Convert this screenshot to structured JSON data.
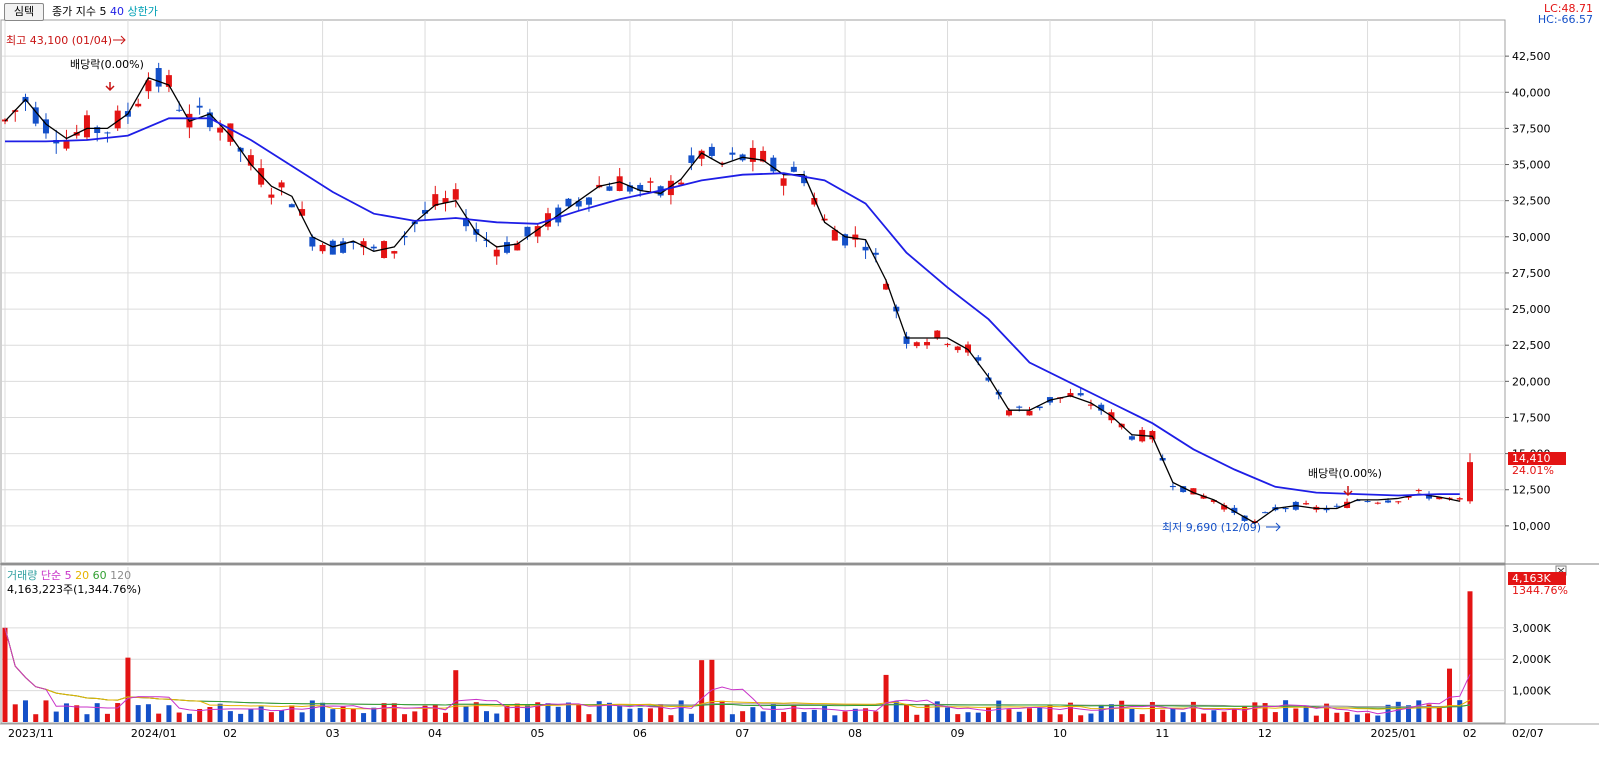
{
  "toolbar": {
    "button_label": "심텍",
    "indicator_prefix": "종가 지수",
    "ma_short": "5",
    "ma_long": "40",
    "limit_label": "상한가"
  },
  "corner": {
    "lc": "LC:48.71",
    "hc": "HC:-66.57"
  },
  "annotations": {
    "high": "최고 43,100 (01/04)",
    "low": "최저 9,690 (12/09)",
    "dividend_1": "배당락(0.00%)",
    "dividend_2": "배당락(0.00%)"
  },
  "price_tag": {
    "price": "14,410",
    "change": "24.01%"
  },
  "volume_legend": {
    "title": "거래량",
    "simple": "단순",
    "p5": "5",
    "p20": "20",
    "p60": "60",
    "p120": "120",
    "current": "4,163,223주(1,344.76%)"
  },
  "volume_tag": {
    "value": "4,163K",
    "change": "1344.76%"
  },
  "colors": {
    "up": "#e31414",
    "down": "#1450c8",
    "ma5": "#000000",
    "ma40": "#1e1ee6",
    "grid": "#dcdcdc",
    "vol_ma5": "#c832c8",
    "vol_ma20": "#e6b400",
    "vol_ma60": "#32a032",
    "vol_ma120": "#8c8c8c"
  },
  "chart_data": [
    {
      "type": "candlestick",
      "y_axis_labels": [
        "42,500",
        "40,000",
        "37,500",
        "35,000",
        "32,500",
        "30,000",
        "27,500",
        "25,000",
        "22,500",
        "20,000",
        "17,500",
        "15,000",
        "12,500",
        "10,000"
      ],
      "ylim": [
        7500,
        45000
      ],
      "x_labels": [
        "2023/11",
        "2024/01",
        "02",
        "03",
        "04",
        "05",
        "06",
        "07",
        "08",
        "09",
        "10",
        "11",
        "12",
        "2025/01",
        "02",
        "02/07"
      ],
      "series": [
        {
          "name": "MA 5",
          "points": [
            [
              0,
              38000
            ],
            [
              2,
              39500
            ],
            [
              4,
              37800
            ],
            [
              6,
              36800
            ],
            [
              8,
              37500
            ],
            [
              10,
              37500
            ],
            [
              12,
              38500
            ],
            [
              14,
              41000
            ],
            [
              16,
              40500
            ],
            [
              18,
              38000
            ],
            [
              20,
              38500
            ],
            [
              22,
              37000
            ],
            [
              24,
              35000
            ],
            [
              26,
              33500
            ],
            [
              28,
              32800
            ],
            [
              30,
              30000
            ],
            [
              32,
              29300
            ],
            [
              34,
              29700
            ],
            [
              36,
              29000
            ],
            [
              38,
              29300
            ],
            [
              40,
              31000
            ],
            [
              42,
              32200
            ],
            [
              44,
              32500
            ],
            [
              46,
              30300
            ],
            [
              48,
              29300
            ],
            [
              50,
              29500
            ],
            [
              52,
              30500
            ],
            [
              54,
              31500
            ],
            [
              56,
              32500
            ],
            [
              58,
              33500
            ],
            [
              60,
              33800
            ],
            [
              62,
              33200
            ],
            [
              64,
              33000
            ],
            [
              66,
              34000
            ],
            [
              68,
              35800
            ],
            [
              70,
              35000
            ],
            [
              72,
              35500
            ],
            [
              74,
              35300
            ],
            [
              76,
              34300
            ],
            [
              78,
              34300
            ],
            [
              80,
              31000
            ],
            [
              82,
              30000
            ],
            [
              84,
              29800
            ],
            [
              86,
              27000
            ],
            [
              88,
              23000
            ],
            [
              90,
              23000
            ],
            [
              92,
              23000
            ],
            [
              94,
              22200
            ],
            [
              96,
              20300
            ],
            [
              98,
              18000
            ],
            [
              100,
              18000
            ],
            [
              102,
              18700
            ],
            [
              104,
              19000
            ],
            [
              106,
              18500
            ],
            [
              108,
              17600
            ],
            [
              110,
              16300
            ],
            [
              112,
              16200
            ],
            [
              114,
              13000
            ],
            [
              116,
              12300
            ],
            [
              118,
              11800
            ],
            [
              120,
              11000
            ],
            [
              122,
              10200
            ],
            [
              124,
              11200
            ],
            [
              126,
              11400
            ],
            [
              128,
              11200
            ],
            [
              130,
              11200
            ],
            [
              132,
              11800
            ],
            [
              134,
              11800
            ],
            [
              136,
              11900
            ],
            [
              138,
              12200
            ],
            [
              140,
              12000
            ],
            [
              142,
              11700
            ]
          ]
        },
        {
          "name": "MA 40",
          "points": [
            [
              0,
              36600
            ],
            [
              4,
              36600
            ],
            [
              8,
              36700
            ],
            [
              12,
              37000
            ],
            [
              16,
              38200
            ],
            [
              20,
              38200
            ],
            [
              24,
              36700
            ],
            [
              28,
              34900
            ],
            [
              32,
              33100
            ],
            [
              36,
              31600
            ],
            [
              40,
              31100
            ],
            [
              44,
              31300
            ],
            [
              48,
              31000
            ],
            [
              52,
              30900
            ],
            [
              56,
              31800
            ],
            [
              60,
              32600
            ],
            [
              64,
              33200
            ],
            [
              68,
              33900
            ],
            [
              72,
              34300
            ],
            [
              76,
              34400
            ],
            [
              80,
              33900
            ],
            [
              84,
              32300
            ],
            [
              88,
              28900
            ],
            [
              92,
              26500
            ],
            [
              96,
              24300
            ],
            [
              100,
              21300
            ],
            [
              104,
              19900
            ],
            [
              108,
              18500
            ],
            [
              112,
              17100
            ],
            [
              116,
              15300
            ],
            [
              120,
              13900
            ],
            [
              124,
              12700
            ],
            [
              128,
              12300
            ],
            [
              132,
              12200
            ],
            [
              136,
              12100
            ],
            [
              140,
              12200
            ],
            [
              142,
              12200
            ]
          ]
        }
      ]
    },
    {
      "type": "bar",
      "title": "거래량",
      "y_axis_labels": [
        "3,000K",
        "2,000K",
        "1,000K"
      ],
      "ylim": [
        0,
        4300
      ],
      "spikes": [
        {
          "index": 0,
          "value": 3000,
          "up": true
        },
        {
          "index": 12,
          "value": 2050,
          "up": true
        },
        {
          "index": 44,
          "value": 1650,
          "up": true
        },
        {
          "index": 68,
          "value": 1970,
          "up": true
        },
        {
          "index": 69,
          "value": 1980,
          "up": true
        },
        {
          "index": 86,
          "value": 1500,
          "up": true
        },
        {
          "index": 141,
          "value": 1700,
          "up": true
        },
        {
          "index": 143,
          "value": 4163,
          "up": true
        }
      ]
    }
  ]
}
